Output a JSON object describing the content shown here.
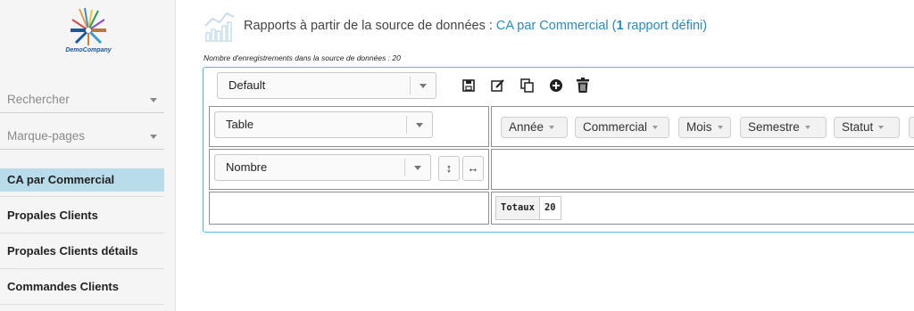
{
  "sidebar": {
    "brand": "DemoCompany",
    "search_label": "Rechercher",
    "bookmarks_label": "Marque-pages",
    "items": [
      {
        "label": "CA par Commercial",
        "active": true
      },
      {
        "label": "Propales Clients",
        "active": false
      },
      {
        "label": "Propales Clients détails",
        "active": false
      },
      {
        "label": "Commandes Clients",
        "active": false
      }
    ]
  },
  "header": {
    "title_prefix": "Rapports à partir de la source de données : ",
    "source_name": "CA par Commercial",
    "open_paren": " (",
    "report_count": "1",
    "count_suffix": " rapport défini)"
  },
  "record_count_text": "Nombre d'enregistrements dans la source de données : 20",
  "pivot": {
    "report_select": "Default",
    "renderer_select": "Table",
    "aggregator_select": "Nombre",
    "attributes": [
      "Année",
      "Commercial",
      "Mois",
      "Semestre",
      "Statut"
    ],
    "row_order_icon": "↕",
    "col_order_icon": "↔",
    "totals_label": "Totaux",
    "totals_value": "20"
  },
  "colors": {
    "accent": "#2a8bc0",
    "active_item_bg": "#b8dcea",
    "panel_border": "#5ab8d8"
  }
}
